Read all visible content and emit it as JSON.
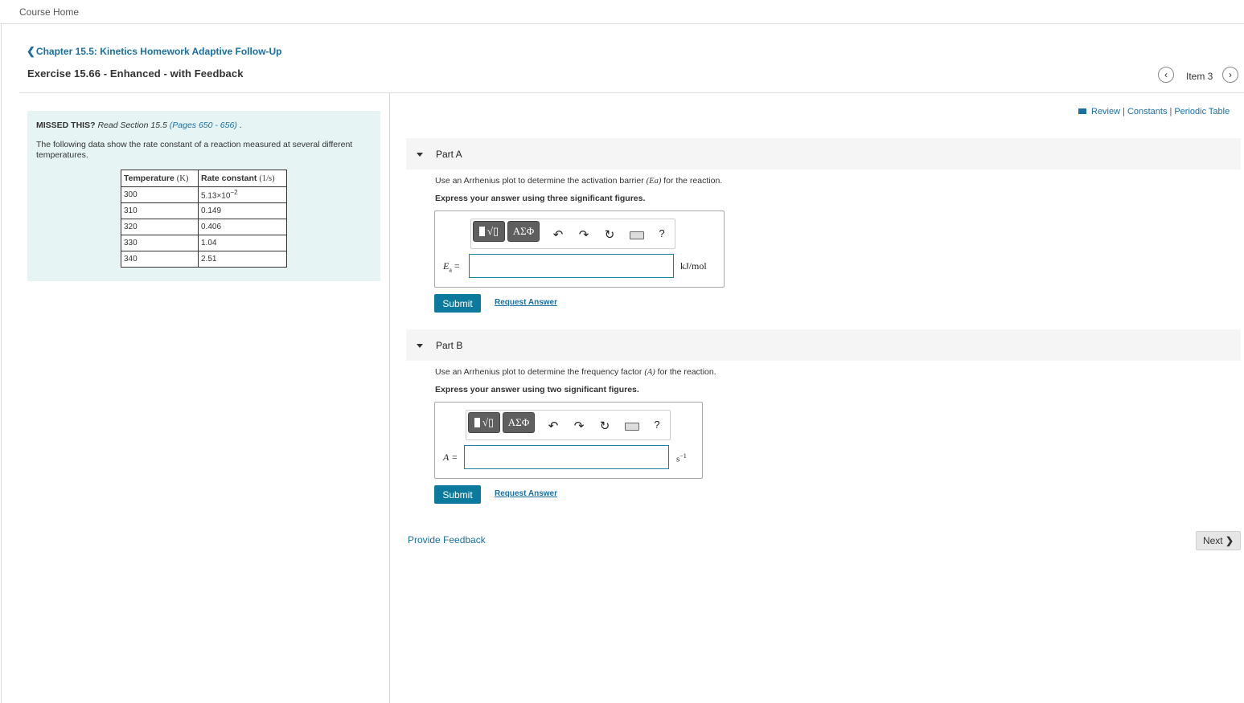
{
  "header": {
    "course_home": "Course Home",
    "chapter_link": "Chapter 15.5: Kinetics Homework Adaptive Follow-Up",
    "exercise_title": "Exercise 15.66 - Enhanced - with Feedback",
    "item_label": "Item 3"
  },
  "resources": {
    "review": "Review",
    "constants": "Constants",
    "periodic_table": "Periodic Table",
    "separator": "|"
  },
  "missed": {
    "label": "MISSED THIS?",
    "read": "Read Section 15.5",
    "pages": "(Pages 650 - 656)",
    "end": ".",
    "description": "The following data show the rate constant of a reaction measured at several different temperatures."
  },
  "table": {
    "headers": [
      "Temperature",
      "(K)",
      "Rate constant",
      "(1/s)"
    ],
    "rows": [
      [
        "300",
        "5.13×10",
        "−2"
      ],
      [
        "310",
        "0.149",
        ""
      ],
      [
        "320",
        "0.406",
        ""
      ],
      [
        "330",
        "1.04",
        ""
      ],
      [
        "340",
        "2.51",
        ""
      ]
    ]
  },
  "toolbar": {
    "template_symbol": "√▯",
    "greek": "ΑΣΦ",
    "undo": "↶",
    "redo": "↷",
    "reset": "↻",
    "help": "?"
  },
  "partA": {
    "title": "Part A",
    "question_pre": "Use an Arrhenius plot to determine the activation barrier",
    "question_sym": "(Ea)",
    "question_post": "for the reaction.",
    "instruction": "Express your answer using three significant figures.",
    "var_label": "Ea =",
    "input_value": "",
    "unit": "kJ/mol",
    "submit": "Submit",
    "request": "Request Answer"
  },
  "partB": {
    "title": "Part B",
    "question_pre": "Use an Arrhenius plot to determine the frequency factor",
    "question_sym": "(A)",
    "question_post": "for the reaction.",
    "instruction": "Express your answer using two significant figures.",
    "var_label": "A =",
    "input_value": "",
    "unit_base": "s",
    "unit_exp": "−1",
    "submit": "Submit",
    "request": "Request Answer"
  },
  "footer": {
    "feedback": "Provide Feedback",
    "next": "Next"
  },
  "colors": {
    "accent": "#0b7a9c",
    "link": "#1a6fa0",
    "panel": "#e6f4f4"
  }
}
